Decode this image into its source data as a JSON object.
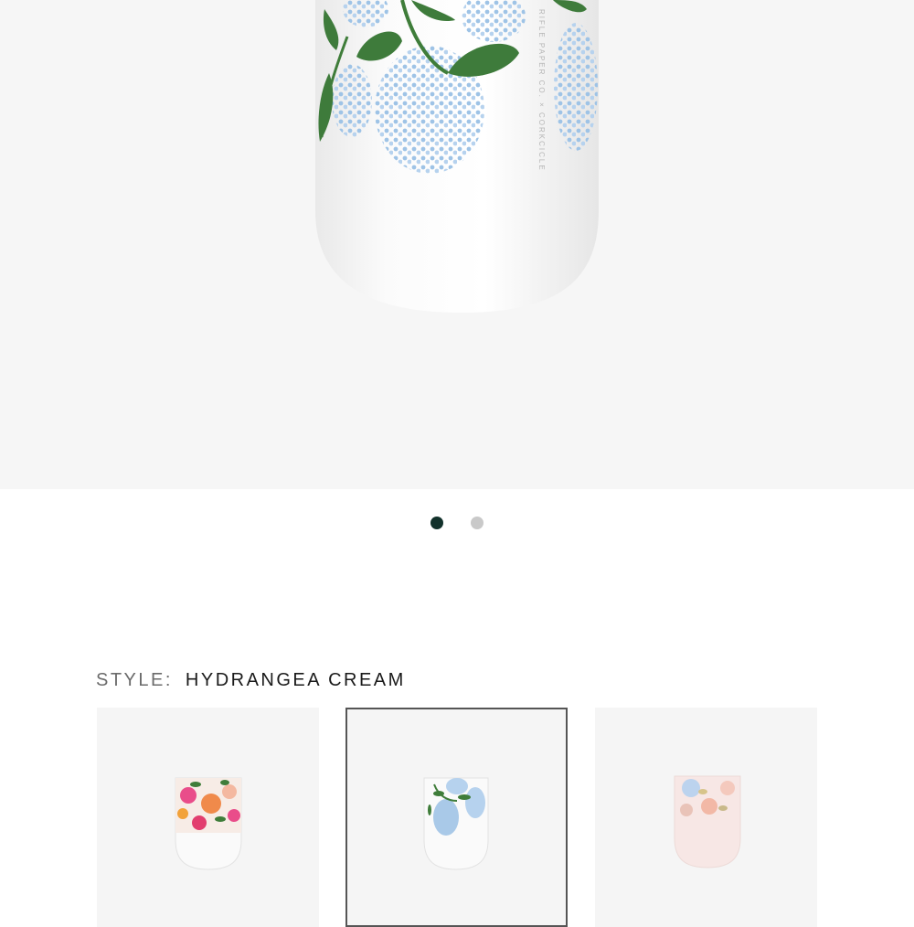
{
  "product_image": {
    "mug_imprint": "RIFLE PAPER CO. × CORKCICLE"
  },
  "carousel": {
    "slide_count": 2,
    "active_slide": 1,
    "dot_colors": {
      "active": "#12312b",
      "inactive": "#c9c9c9"
    }
  },
  "style_selector": {
    "label": "STYLE:",
    "selected": "HYDRANGEA CREAM",
    "options": [
      {
        "style": "garden-party",
        "colors": [
          "#e36a4a",
          "#e94d8a",
          "#f2a23a",
          "#3f7d3a"
        ]
      },
      {
        "style": "hydrangea-cream",
        "colors": [
          "#a9c9e8",
          "#3f7d3a"
        ]
      },
      {
        "style": "blush-floral",
        "colors": [
          "#bcd3ee",
          "#f2b8a6",
          "#f7e7e5"
        ]
      }
    ]
  }
}
